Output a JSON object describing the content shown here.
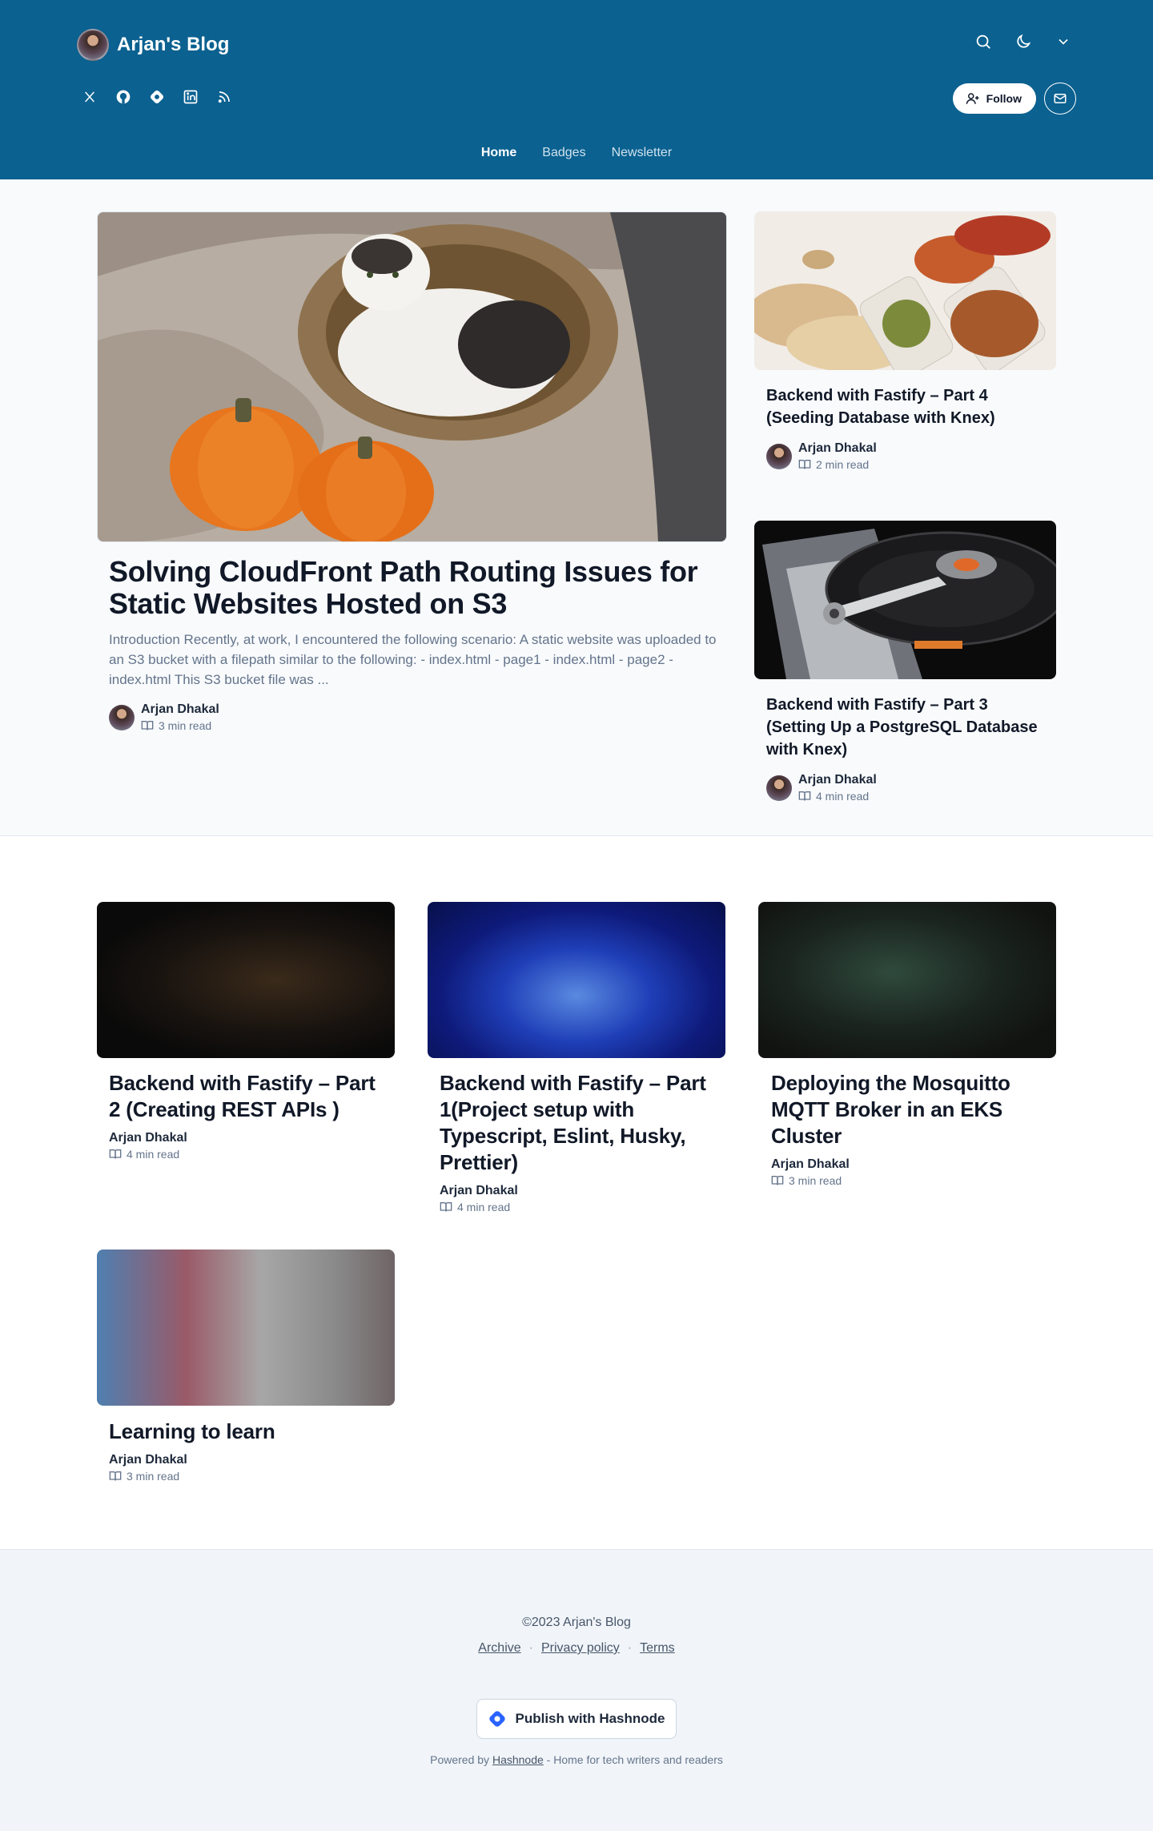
{
  "header": {
    "blog_name": "Arjan's Blog",
    "follow_label": "Follow",
    "nav": [
      {
        "label": "Home",
        "active": true
      },
      {
        "label": "Badges",
        "active": false
      },
      {
        "label": "Newsletter",
        "active": false
      }
    ],
    "socials": [
      "x-icon",
      "github-icon",
      "hashnode-icon",
      "linkedin-icon",
      "rss-icon"
    ],
    "actions": [
      "search-icon",
      "moon-icon",
      "chevron-down-icon"
    ],
    "colors": {
      "header_bg": "#0b6190"
    }
  },
  "featured": {
    "title": "Solving CloudFront Path Routing Issues for Static Websites Hosted on S3",
    "excerpt": "Introduction Recently, at work, I encountered the following scenario: A static website was uploaded to an S3 bucket with a filepath similar to the following: - index.html - page1 - index.html - page2 - index.html This S3 bucket file was ...",
    "author": "Arjan Dhakal",
    "read_time": "3 min read"
  },
  "side_posts": [
    {
      "title": "Backend with Fastify – Part 4 (Seeding Database with Knex)",
      "author": "Arjan Dhakal",
      "read_time": "2 min read"
    },
    {
      "title": "Backend with Fastify – Part 3 (Setting Up a PostgreSQL Database with Knex)",
      "author": "Arjan Dhakal",
      "read_time": "4 min read"
    }
  ],
  "posts": [
    {
      "title": "Backend with Fastify – Part 2 (Creating REST APIs )",
      "author": "Arjan Dhakal",
      "read_time": "4 min read"
    },
    {
      "title": "Backend with Fastify – Part 1(Project setup with Typescript, Eslint, Husky, Prettier)",
      "author": "Arjan Dhakal",
      "read_time": "4 min read"
    },
    {
      "title": "Deploying the Mosquitto MQTT Broker in an EKS Cluster",
      "author": "Arjan Dhakal",
      "read_time": "3 min read"
    },
    {
      "title": "Learning to learn",
      "author": "Arjan Dhakal",
      "read_time": "3 min read"
    }
  ],
  "footer": {
    "copyright": "©2023 Arjan's Blog",
    "links": [
      "Archive",
      "Privacy policy",
      "Terms"
    ],
    "publish_label": "Publish with Hashnode",
    "powered_prefix": "Powered by",
    "powered_link": "Hashnode",
    "powered_suffix": "- Home for tech writers and readers"
  }
}
